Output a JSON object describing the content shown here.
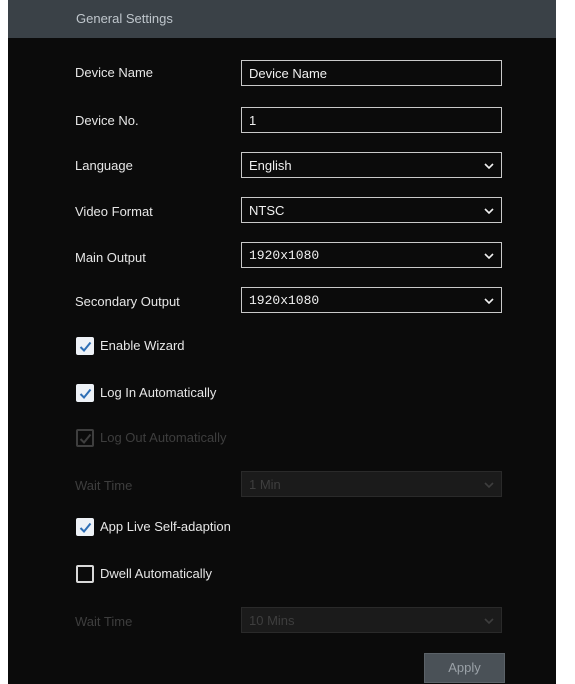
{
  "header": {
    "title": "General Settings"
  },
  "form": {
    "device_name": {
      "label": "Device Name",
      "value": "Device Name"
    },
    "device_no": {
      "label": "Device No.",
      "value": "1"
    },
    "language": {
      "label": "Language",
      "value": "English"
    },
    "video_format": {
      "label": "Video Format",
      "value": "NTSC"
    },
    "main_output": {
      "label": "Main Output",
      "value": "1920x1080"
    },
    "secondary_output": {
      "label": "Secondary Output",
      "value": "1920x1080"
    },
    "enable_wizard": {
      "label": "Enable Wizard",
      "checked": true
    },
    "log_in_auto": {
      "label": "Log In Automatically",
      "checked": true
    },
    "log_out_auto": {
      "label": "Log Out Automatically",
      "checked": true,
      "disabled": true
    },
    "wait_time_logout": {
      "label": "Wait Time",
      "value": "1 Min",
      "disabled": true
    },
    "app_live": {
      "label": "App Live Self-adaption",
      "checked": true
    },
    "dwell_auto": {
      "label": "Dwell Automatically",
      "checked": false
    },
    "wait_time_dwell": {
      "label": "Wait Time",
      "value": "10 Mins",
      "disabled": true
    }
  },
  "footer": {
    "apply_label": "Apply"
  },
  "icons": {
    "check": "checkmark-icon",
    "chevron": "chevron-down-icon"
  }
}
